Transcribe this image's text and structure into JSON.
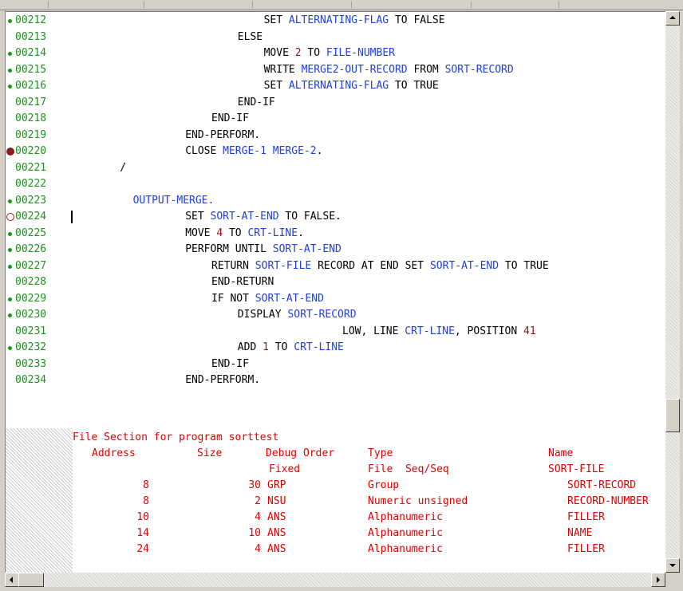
{
  "editor": {
    "lines": [
      {
        "no": "00212",
        "marker": "dot",
        "indent": 28,
        "tokens": [
          [
            "k",
            "SET "
          ],
          [
            "v",
            "ALTERNATING-FLAG"
          ],
          [
            "k",
            " TO FALSE"
          ]
        ]
      },
      {
        "no": "00213",
        "marker": "",
        "indent": 24,
        "tokens": [
          [
            "k",
            "ELSE"
          ]
        ]
      },
      {
        "no": "00214",
        "marker": "dot",
        "indent": 28,
        "tokens": [
          [
            "k",
            "MOVE "
          ],
          [
            "n",
            "2"
          ],
          [
            "k",
            " TO "
          ],
          [
            "v",
            "FILE-NUMBER"
          ]
        ]
      },
      {
        "no": "00215",
        "marker": "dot",
        "indent": 28,
        "tokens": [
          [
            "k",
            "WRITE "
          ],
          [
            "v",
            "MERGE2-OUT-RECORD"
          ],
          [
            "k",
            " FROM "
          ],
          [
            "v",
            "SORT-RECORD"
          ]
        ]
      },
      {
        "no": "00216",
        "marker": "dot",
        "indent": 28,
        "tokens": [
          [
            "k",
            "SET "
          ],
          [
            "v",
            "ALTERNATING-FLAG"
          ],
          [
            "k",
            " TO TRUE"
          ]
        ]
      },
      {
        "no": "00217",
        "marker": "",
        "indent": 24,
        "tokens": [
          [
            "k",
            "END-IF"
          ]
        ]
      },
      {
        "no": "00218",
        "marker": "",
        "indent": 20,
        "tokens": [
          [
            "k",
            "END-IF"
          ]
        ]
      },
      {
        "no": "00219",
        "marker": "",
        "indent": 16,
        "tokens": [
          [
            "k",
            "END-PERFORM."
          ]
        ]
      },
      {
        "no": "00220",
        "marker": "bp",
        "indent": 16,
        "tokens": [
          [
            "k",
            "CLOSE "
          ],
          [
            "v",
            "MERGE-1"
          ],
          [
            "k",
            " "
          ],
          [
            "v",
            "MERGE-2"
          ],
          [
            "k",
            "."
          ]
        ]
      },
      {
        "no": "00221",
        "marker": "",
        "indent": 6,
        "tokens": [
          [
            "k",
            "/"
          ]
        ]
      },
      {
        "no": "00222",
        "marker": "",
        "indent": 0,
        "tokens": []
      },
      {
        "no": "00223",
        "marker": "dot",
        "indent": 8,
        "tokens": [
          [
            "v",
            "OUTPUT-MERGE."
          ]
        ]
      },
      {
        "no": "00224",
        "marker": "bp-off",
        "indent": 16,
        "caret": true,
        "tokens": [
          [
            "k",
            "SET "
          ],
          [
            "v",
            "SORT-AT-END"
          ],
          [
            "k",
            " TO FALSE."
          ]
        ]
      },
      {
        "no": "00225",
        "marker": "dot",
        "indent": 16,
        "tokens": [
          [
            "k",
            "MOVE "
          ],
          [
            "n",
            "4"
          ],
          [
            "k",
            " TO "
          ],
          [
            "v",
            "CRT-LINE"
          ],
          [
            "k",
            "."
          ]
        ]
      },
      {
        "no": "00226",
        "marker": "dot",
        "indent": 16,
        "tokens": [
          [
            "k",
            "PERFORM UNTIL "
          ],
          [
            "v",
            "SORT-AT-END"
          ]
        ]
      },
      {
        "no": "00227",
        "marker": "dot",
        "indent": 20,
        "tokens": [
          [
            "k",
            "RETURN "
          ],
          [
            "v",
            "SORT-FILE"
          ],
          [
            "k",
            " RECORD AT END SET "
          ],
          [
            "v",
            "SORT-AT-END"
          ],
          [
            "k",
            " TO TRUE"
          ]
        ]
      },
      {
        "no": "00228",
        "marker": "",
        "indent": 20,
        "tokens": [
          [
            "k",
            "END-RETURN"
          ]
        ]
      },
      {
        "no": "00229",
        "marker": "dot",
        "indent": 20,
        "tokens": [
          [
            "k",
            "IF NOT "
          ],
          [
            "v",
            "SORT-AT-END"
          ]
        ]
      },
      {
        "no": "00230",
        "marker": "dot",
        "indent": 24,
        "tokens": [
          [
            "k",
            "DISPLAY "
          ],
          [
            "v",
            "SORT-RECORD"
          ]
        ]
      },
      {
        "no": "00231",
        "marker": "",
        "indent": 40,
        "tokens": [
          [
            "k",
            "LOW, LINE "
          ],
          [
            "v",
            "CRT-LINE"
          ],
          [
            "k",
            ", POSITION "
          ],
          [
            "n",
            "41"
          ]
        ]
      },
      {
        "no": "00232",
        "marker": "dot",
        "indent": 24,
        "tokens": [
          [
            "k",
            "ADD "
          ],
          [
            "n",
            "1"
          ],
          [
            "k",
            " TO "
          ],
          [
            "v",
            "CRT-LINE"
          ]
        ]
      },
      {
        "no": "00233",
        "marker": "",
        "indent": 20,
        "tokens": [
          [
            "k",
            "END-IF"
          ]
        ]
      },
      {
        "no": "00234",
        "marker": "",
        "indent": 16,
        "tokens": [
          [
            "k",
            "END-PERFORM."
          ]
        ]
      }
    ]
  },
  "file_section": {
    "title": "File Section for program sorttest",
    "headers": {
      "address": "Address",
      "size": "Size",
      "debug_order": "Debug Order",
      "type": "Type",
      "name": "Name"
    },
    "subheaders": {
      "fixed": "Fixed",
      "file_seq": "File  Seq/Seq",
      "sort_file": "SORT-FILE"
    },
    "rows": [
      {
        "address": "8",
        "size": "30",
        "debug": "GRP",
        "type": "Group",
        "name": "SORT-RECORD"
      },
      {
        "address": "8",
        "size": "2",
        "debug": "NSU",
        "type": "Numeric unsigned",
        "name": "RECORD-NUMBER"
      },
      {
        "address": "10",
        "size": "4",
        "debug": "ANS",
        "type": "Alphanumeric",
        "name": "FILLER"
      },
      {
        "address": "14",
        "size": "10",
        "debug": "ANS",
        "type": "Alphanumeric",
        "name": "NAME"
      },
      {
        "address": "24",
        "size": "4",
        "debug": "ANS",
        "type": "Alphanumeric",
        "name": "FILLER"
      }
    ]
  },
  "colors": {
    "keyword": "#000000",
    "variable": "#1f3fd6",
    "number": "#a01010",
    "line_number": "#1f8f1f",
    "file_section": "#e00000"
  }
}
